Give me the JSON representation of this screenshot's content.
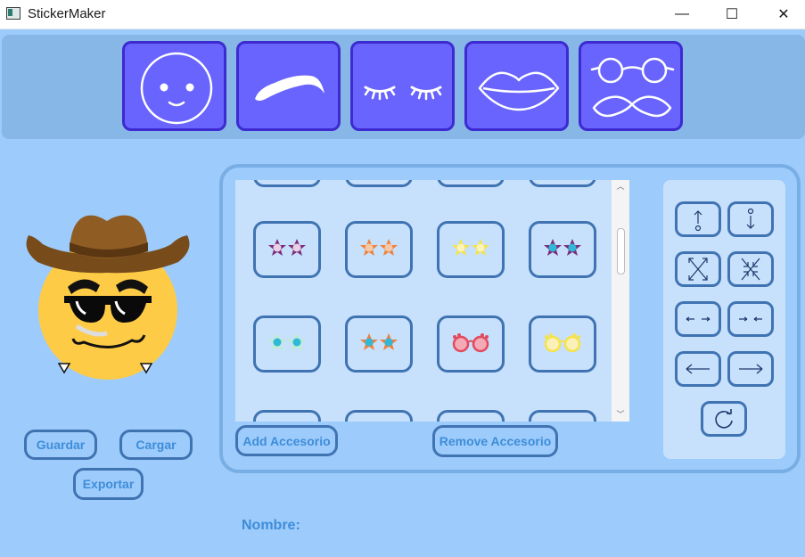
{
  "window": {
    "title": "StickerMaker",
    "controls": {
      "minimize": "—",
      "maximize": "☐",
      "close": "✕"
    }
  },
  "categories": [
    "face-icon",
    "eyebrow-icon",
    "eyelashes-icon",
    "lips-icon",
    "glasses-mustache-icon"
  ],
  "accessory_grid": {
    "rows": [
      [
        {
          "icon": "star-glasses-purple"
        },
        {
          "icon": "star-glasses-orange"
        },
        {
          "icon": "star-glasses-yellow"
        },
        {
          "icon": "star-glasses-purple-blue"
        }
      ],
      [
        {
          "icon": "star-glasses-green"
        },
        {
          "icon": "star-glasses-orange-blue"
        },
        {
          "icon": "round-glasses-red"
        },
        {
          "icon": "round-glasses-yellow"
        }
      ]
    ]
  },
  "buttons": {
    "add": "Add Accesorio",
    "remove": "Remove Accesorio",
    "save": "Guardar",
    "load": "Cargar",
    "export": "Exportar"
  },
  "transform_controls": [
    "move-up-icon",
    "move-down-icon",
    "expand-icon",
    "shrink-icon",
    "widen-icon",
    "narrow-icon",
    "move-left-icon",
    "move-right-icon",
    "rotate-icon"
  ],
  "name_label": "Nombre:"
}
